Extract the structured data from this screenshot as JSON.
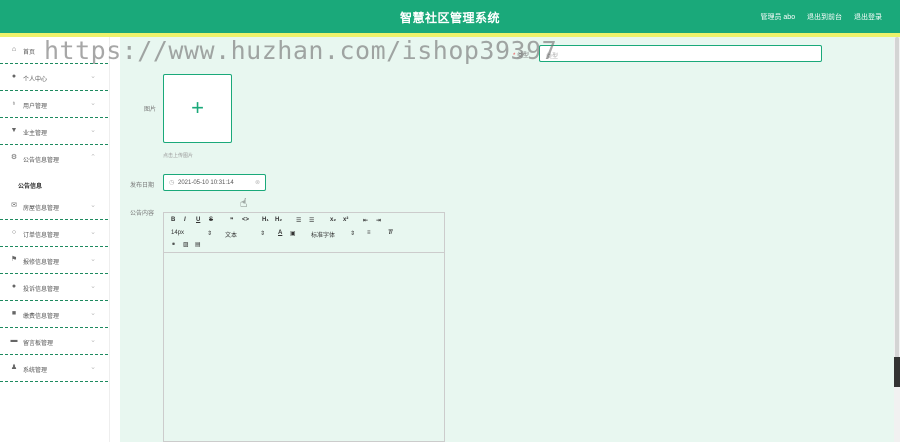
{
  "app": {
    "title": "智慧社区管理系统",
    "user_link": "管理员 abo",
    "backend_link": "退出到前台",
    "logout_link": "退出登录"
  },
  "sidebar": {
    "items": [
      {
        "label": "首页",
        "icon": "home-icon"
      },
      {
        "label": "个人中心",
        "icon": "user-icon"
      },
      {
        "label": "用户管理",
        "icon": "mic-icon"
      },
      {
        "label": "业主管理",
        "icon": "shield-icon"
      },
      {
        "label": "公告信息管理",
        "icon": "gear-icon"
      },
      {
        "label": "房屋信息管理",
        "icon": "mail-icon"
      },
      {
        "label": "订单信息管理",
        "icon": "circle-icon"
      },
      {
        "label": "报修信息管理",
        "icon": "flag-icon"
      },
      {
        "label": "投诉信息管理",
        "icon": "pin-icon"
      },
      {
        "label": "缴费信息管理",
        "icon": "bag-icon"
      },
      {
        "label": "留言板管理",
        "icon": "monitor-icon"
      },
      {
        "label": "系统管理",
        "icon": "person-icon"
      }
    ],
    "sub_item": "公告信息"
  },
  "form": {
    "type_label": "类型",
    "type_placeholder": "类型",
    "image_label": "图片",
    "upload_hint": "点击上传图片",
    "date_label": "发布日期",
    "date_value": "2021-05-10 10:31:14",
    "content_label": "公告内容"
  },
  "editor": {
    "font_size": "14px",
    "paragraph": "文本",
    "font_family": "标准字体"
  },
  "watermark": "https://www.huzhan.com/ishop39397",
  "colors": {
    "header": "#1aa97a",
    "accent_line": "#eef26b",
    "main_bg": "#e8f7f0"
  }
}
